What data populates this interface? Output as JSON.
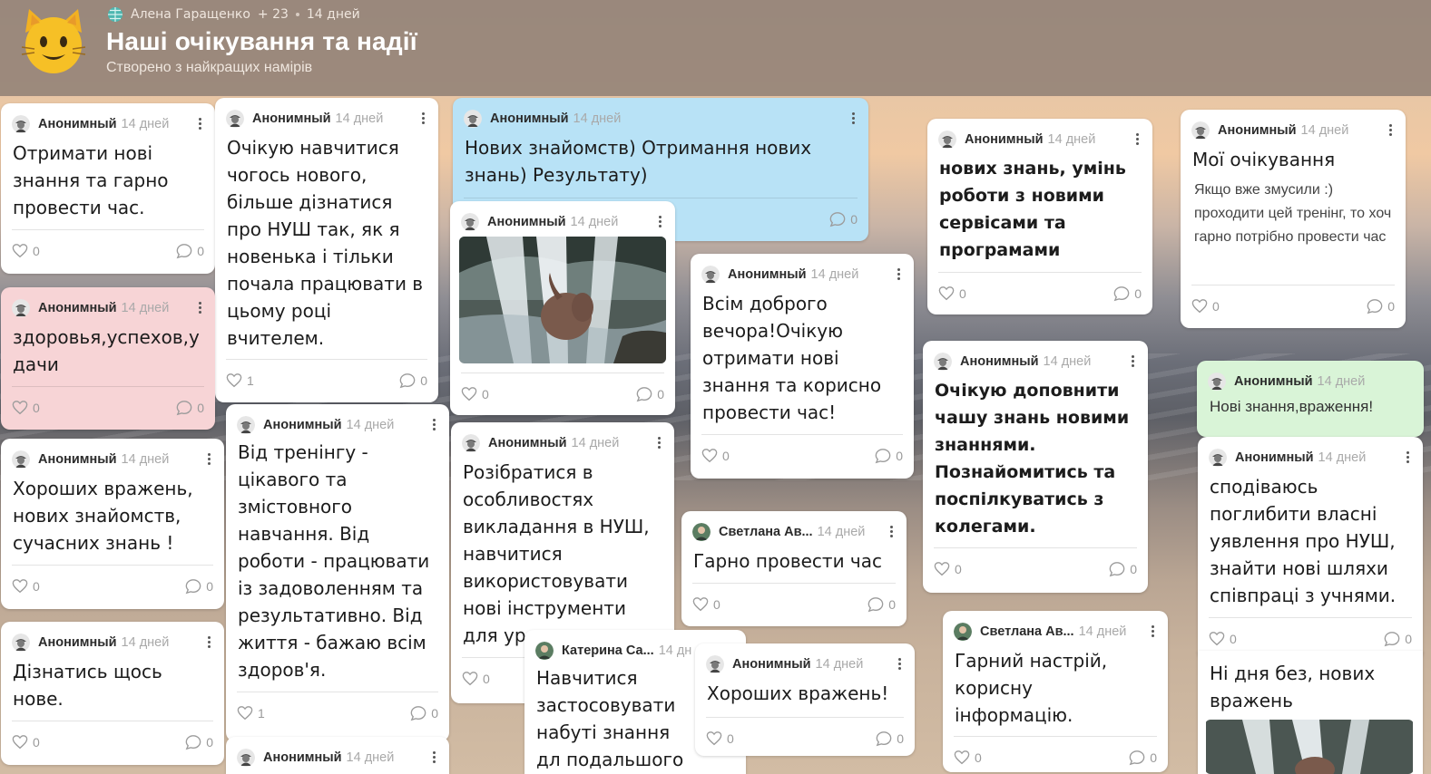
{
  "header": {
    "owner": "Алена Гаращенко",
    "plus_count": "+ 23",
    "age": "14 дней",
    "title": "Наші очікування та надії",
    "subtitle": "Створено з найкращих намірів"
  },
  "colors": {
    "header_bg": "#968478",
    "card_white": "#ffffff",
    "card_blue": "#b8e2f6",
    "card_pink": "#f7d4d6",
    "card_green": "#d9f4d7"
  },
  "cards": [
    {
      "author": "Анонимный",
      "time": "14 дней",
      "text": "Отримати нові знання та гарно провести час.",
      "likes": "0",
      "comments": "0"
    },
    {
      "author": "Анонимный",
      "time": "14 дней",
      "text": "Очікую навчитися чогось нового, більше дізнатися про НУШ так, як я новенька і тільки почала працювати в цьому році вчителем.",
      "likes": "1",
      "comments": "0"
    },
    {
      "author": "Анонимный",
      "time": "14 дней",
      "text": "Нових знайомств) Отримання нових знань) Результату)",
      "likes": "0",
      "comments": "0"
    },
    {
      "author": "Анонимный",
      "time": "14 дней",
      "text": "",
      "likes": "0",
      "comments": "0"
    },
    {
      "author": "Анонимный",
      "time": "14 дней",
      "text": "нових знань, умінь роботи з новими сервісами та програмами",
      "likes": "0",
      "comments": "0"
    },
    {
      "author": "Анонимный",
      "time": "14 дней",
      "title": "Мої очікування",
      "text": "Якщо вже змусили :) проходити цей тренінг, то хоч гарно потрібно провести час",
      "likes": "0",
      "comments": "0"
    },
    {
      "author": "Анонимный",
      "time": "14 дней",
      "text": "здоровья,успехов,удачи",
      "likes": "0",
      "comments": "0"
    },
    {
      "author": "Анонимный",
      "time": "14 дней",
      "text": "Всім доброго вечора!Очікую отримати нові знання та корисно провести час!",
      "likes": "0",
      "comments": "0"
    },
    {
      "author": "Анонимный",
      "time": "14 дней",
      "text": "Очікую доповнити чашу знань новими знаннями. Познайомитись та поспілкуватись з колегами.",
      "likes": "0",
      "comments": "0"
    },
    {
      "author": "Анонимный",
      "time": "14 дней",
      "text": "Нові знання,враження!",
      "likes": "",
      "comments": ""
    },
    {
      "author": "Анонимный",
      "time": "14 дней",
      "text": "Від тренінгу - цікавого та змістовного навчання. Від роботи - працювати із задоволенням та результативно. Від життя - бажаю всім здоров'я.",
      "likes": "1",
      "comments": "0"
    },
    {
      "author": "Анонимный",
      "time": "14 дней",
      "text": "Розібратися в особливостях викладання в НУШ, навчитися використовувати нові інструменти для ур",
      "likes": "0",
      "comments": ""
    },
    {
      "author": "Анонимный",
      "time": "14 дней",
      "text": "Хороших вражень, нових знайомств, сучасних знань !",
      "likes": "0",
      "comments": "0"
    },
    {
      "author": "Анонимный",
      "time": "14 дней",
      "text": "сподіваюсь поглибити власні уявлення про НУШ, знайти нові шляхи співпраці з учнями.",
      "likes": "0",
      "comments": "0"
    },
    {
      "author": "Светлана Ав...",
      "time": "14 дней",
      "text": "Гарно провести час",
      "likes": "0",
      "comments": "0"
    },
    {
      "author": "Светлана Ав...",
      "time": "14 дней",
      "text": "Гарний настрій, корисну інформацію.",
      "likes": "0",
      "comments": "0"
    },
    {
      "author": "Анонимный",
      "time": "14 дней",
      "text": "Дізнатись щось нове.",
      "likes": "0",
      "comments": "0"
    },
    {
      "author": "Катерина Са...",
      "time": "14 дн",
      "text": "Навчитися застосовувати набуті знання дл подальшого",
      "likes": "",
      "comments": ""
    },
    {
      "author": "Анонимный",
      "time": "14 дней",
      "text": "Хороших вражень!",
      "likes": "0",
      "comments": "0"
    },
    {
      "author": "Анонимный",
      "time": "14 дней",
      "text": "Ні дня без, нових вражень",
      "likes": "",
      "comments": ""
    },
    {
      "author": "Анонимный",
      "time": "14 дней",
      "text": "",
      "likes": "",
      "comments": ""
    }
  ]
}
